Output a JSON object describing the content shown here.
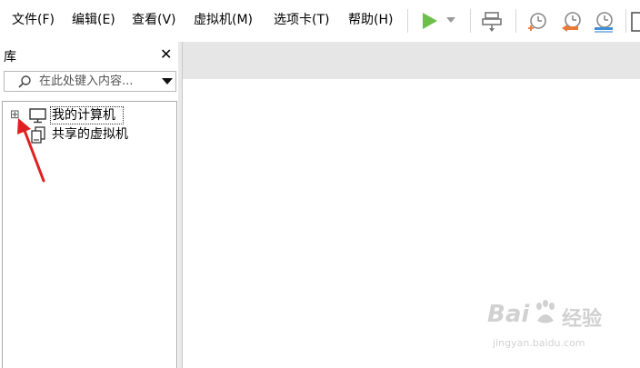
{
  "menubar": {
    "file": "文件(F)",
    "edit": "编辑(E)",
    "view": "查看(V)",
    "vm": "虚拟机(M)",
    "tabs": "选项卡(T)",
    "help": "帮助(H)"
  },
  "toolbar": {
    "play_icon": "play-icon",
    "dropdown_icon": "chevron-down-icon",
    "send_keys_icon": "send-ctrl-alt-del-icon",
    "snapshot_icon": "snapshot-icon",
    "revert_snapshot_icon": "revert-snapshot-icon",
    "snapshot_manager_icon": "snapshot-manager-icon",
    "colors": {
      "play": "#6cc04a",
      "revert": "#e87a3a",
      "manager": "#3f8fd6"
    }
  },
  "library": {
    "title": "库",
    "close_label": "✕",
    "search": {
      "placeholder": "在此处键入内容...",
      "value": ""
    },
    "tree": [
      {
        "label": "我的计算机",
        "expander": "⊞",
        "icon": "computer-icon",
        "selected": true
      },
      {
        "label": "共享的虚拟机",
        "icon": "shared-vms-icon",
        "selected": false
      }
    ]
  },
  "annotation": {
    "arrow_color": "#e02020"
  },
  "watermark": {
    "brand_a": "Bai",
    "brand_b": "经验",
    "url": "jingyan.baidu.com"
  }
}
